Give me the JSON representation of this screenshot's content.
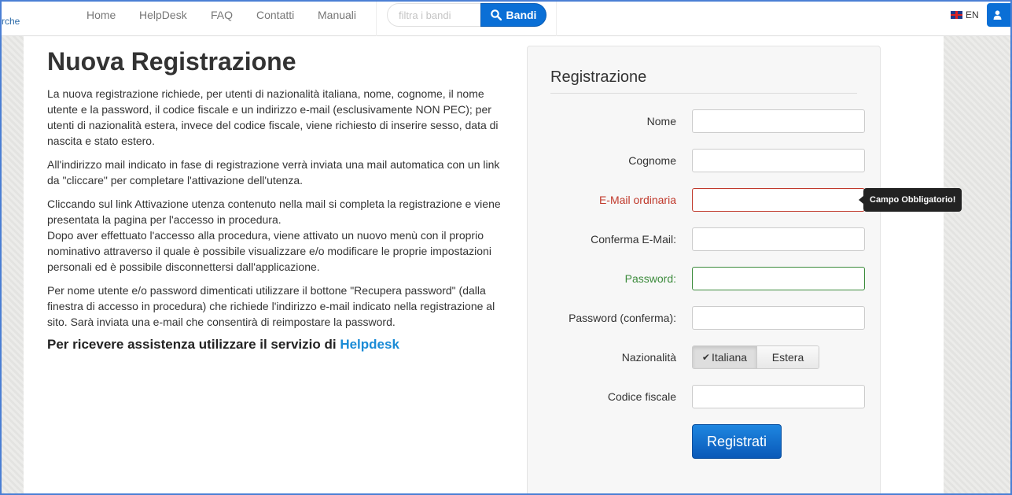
{
  "header": {
    "brand_fragment": "rche",
    "nav": [
      "Home",
      "HelpDesk",
      "FAQ",
      "Contatti",
      "Manuali"
    ],
    "search_placeholder": "filtra i bandi",
    "search_button": "Bandi",
    "search_icon": "magnifier-icon",
    "language": "EN",
    "user_icon": "user-icon"
  },
  "main": {
    "title": "Nuova Registrazione",
    "paragraphs": [
      "La nuova registrazione richiede, per utenti di nazionalità italiana, nome, cognome, il nome utente e la password, il codice fiscale e un indirizzo e-mail (esclusivamente NON PEC); per utenti di nazionalità estera, invece del codice fiscale, viene richiesto di inserire sesso, data di nascita e stato estero.",
      "All'indirizzo mail indicato in fase di registrazione verrà inviata una mail automatica con un link da \"cliccare\" per completare l'attivazione dell'utenza.",
      "Cliccando sul link Attivazione utenza contenuto nella mail si completa la registrazione e viene presentata la pagina per l'accesso in procedura.",
      "Dopo aver effettuato l'accesso alla procedura, viene attivato un nuovo menù con il proprio nominativo attraverso il quale è possibile visualizzare e/o modificare le proprie impostazioni personali ed è possibile disconnettersi dall'applicazione.",
      "Per nome utente e/o password dimenticati utilizzare il bottone \"Recupera password\" (dalla finestra di accesso in procedura) che richiede l'indirizzo e-mail indicato nella registrazione al sito. Sarà inviata una e-mail che consentirà di reimpostare la password."
    ],
    "assist_text": "Per ricevere assistenza utilizzare il servizio di ",
    "assist_link": "Helpdesk"
  },
  "form": {
    "title": "Registrazione",
    "labels": {
      "nome": "Nome",
      "cognome": "Cognome",
      "email": "E-Mail ordinaria",
      "conferma_email": "Conferma E-Mail:",
      "password": "Password:",
      "password_conferma": "Password (conferma):",
      "nazionalita": "Nazionalità",
      "codice_fiscale": "Codice fiscale"
    },
    "tooltip": "Campo Obbligatorio!",
    "nazionalita_options": [
      "Italiana",
      "Estera"
    ],
    "nazionalita_selected": "Italiana",
    "submit": "Registrati",
    "colors": {
      "error": "#c0392b",
      "valid": "#3c8b3c",
      "primary": "#0a6fd6"
    }
  }
}
